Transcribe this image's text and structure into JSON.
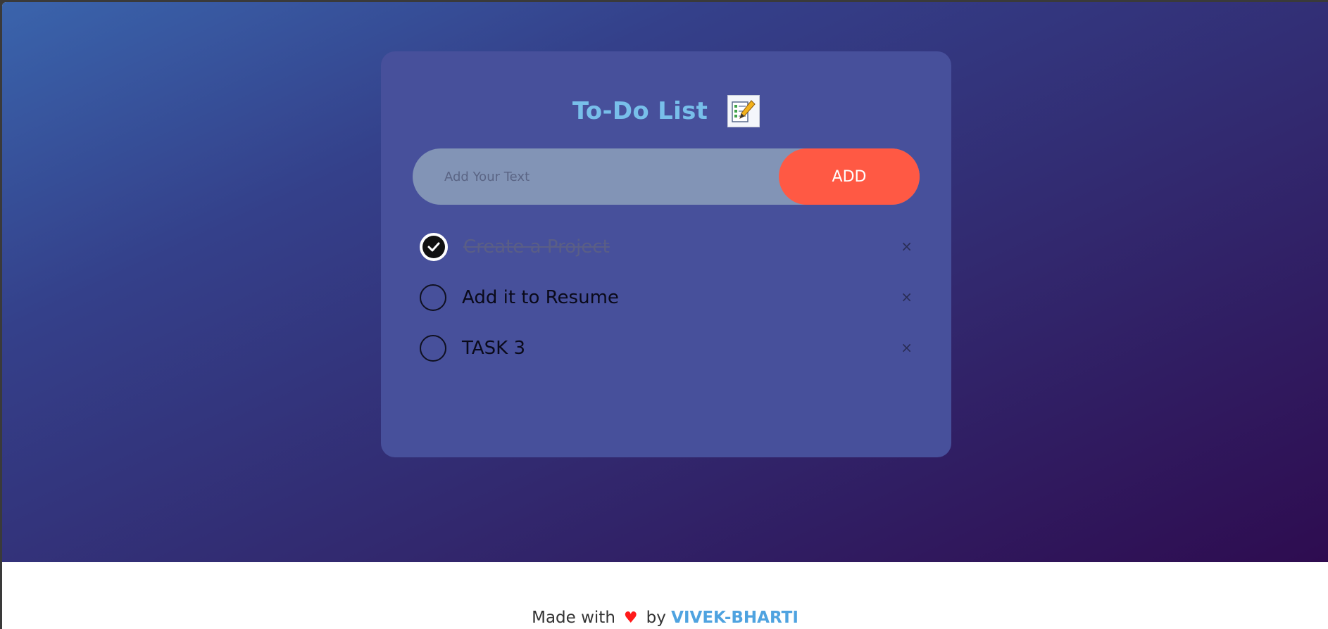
{
  "app": {
    "title": "To-Do List",
    "title_icon": "checklist-pencil-icon"
  },
  "input": {
    "placeholder": "Add Your Text",
    "value": "",
    "add_label": "ADD"
  },
  "tasks": [
    {
      "label": "Create a Project",
      "done": true,
      "delete": "×"
    },
    {
      "label": "Add it to Resume",
      "done": false,
      "delete": "×"
    },
    {
      "label": "TASK 3",
      "done": false,
      "delete": "×"
    }
  ],
  "footer": {
    "made_with": "Made with",
    "heart": "♥",
    "by": "by",
    "author": "VIVEK-BHARTI"
  },
  "colors": {
    "accent": "#78bfea",
    "add_button": "#ff5944",
    "card": "#47509b",
    "heart": "#ff1a1a"
  }
}
